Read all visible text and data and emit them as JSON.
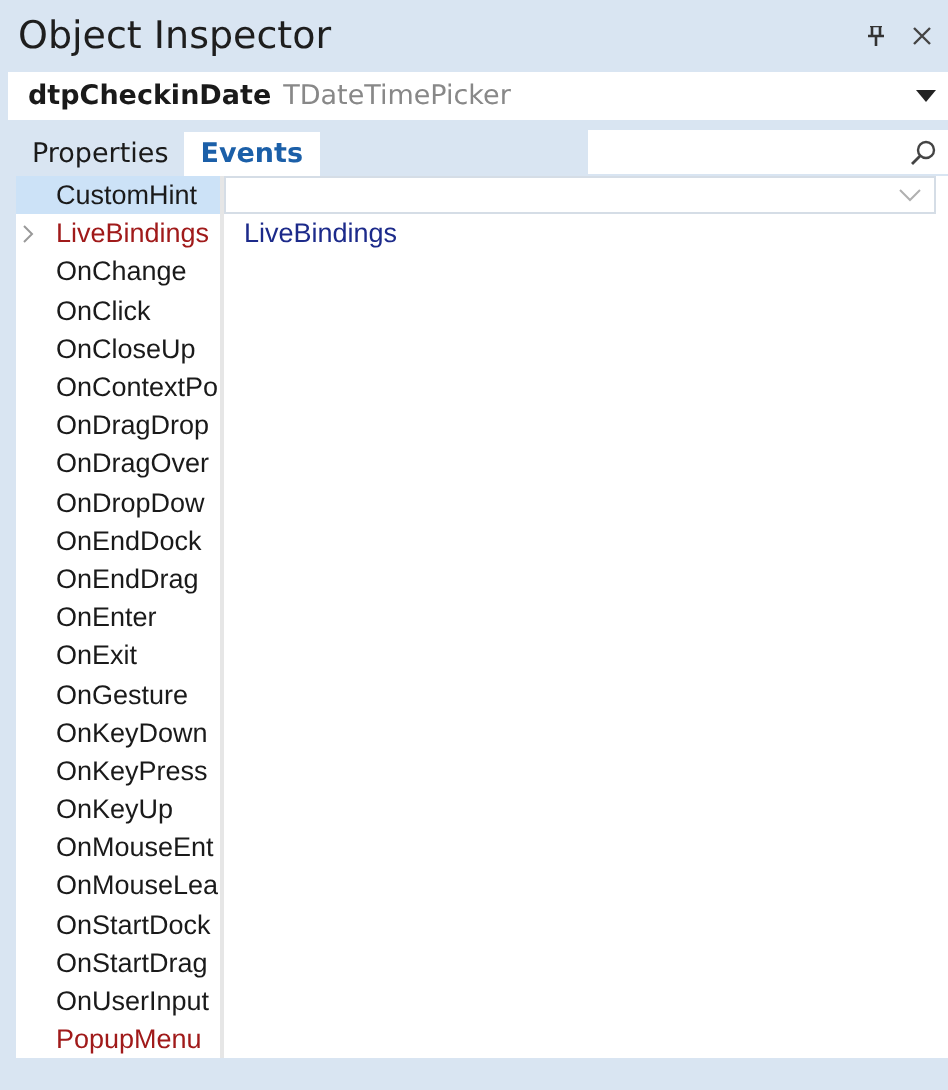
{
  "window": {
    "title": "Object Inspector"
  },
  "component": {
    "name": "dtpCheckinDate",
    "type": "TDateTimePicker"
  },
  "tabs": [
    {
      "label": "Properties",
      "selected": false
    },
    {
      "label": "Events",
      "selected": true
    }
  ],
  "rows": [
    {
      "name": "CustomHint",
      "kind": "event",
      "selected": true,
      "value": ""
    },
    {
      "name": "LiveBindings",
      "kind": "reference",
      "selected": false,
      "expanded": false,
      "value": "LiveBindings"
    },
    {
      "name": "OnChange",
      "kind": "event",
      "selected": false
    },
    {
      "name": "OnClick",
      "kind": "event",
      "selected": false
    },
    {
      "name": "OnCloseUp",
      "kind": "event",
      "selected": false
    },
    {
      "name": "OnContextPo",
      "kind": "event",
      "selected": false
    },
    {
      "name": "OnDragDrop",
      "kind": "event",
      "selected": false
    },
    {
      "name": "OnDragOver",
      "kind": "event",
      "selected": false
    },
    {
      "name": "OnDropDow",
      "kind": "event",
      "selected": false
    },
    {
      "name": "OnEndDock",
      "kind": "event",
      "selected": false
    },
    {
      "name": "OnEndDrag",
      "kind": "event",
      "selected": false
    },
    {
      "name": "OnEnter",
      "kind": "event",
      "selected": false
    },
    {
      "name": "OnExit",
      "kind": "event",
      "selected": false
    },
    {
      "name": "OnGesture",
      "kind": "event",
      "selected": false
    },
    {
      "name": "OnKeyDown",
      "kind": "event",
      "selected": false
    },
    {
      "name": "OnKeyPress",
      "kind": "event",
      "selected": false
    },
    {
      "name": "OnKeyUp",
      "kind": "event",
      "selected": false
    },
    {
      "name": "OnMouseEnt",
      "kind": "event",
      "selected": false
    },
    {
      "name": "OnMouseLea",
      "kind": "event",
      "selected": false
    },
    {
      "name": "OnStartDock",
      "kind": "event",
      "selected": false
    },
    {
      "name": "OnStartDrag",
      "kind": "event",
      "selected": false
    },
    {
      "name": "OnUserInput",
      "kind": "event",
      "selected": false
    },
    {
      "name": "PopupMenu",
      "kind": "reference",
      "selected": false
    }
  ]
}
